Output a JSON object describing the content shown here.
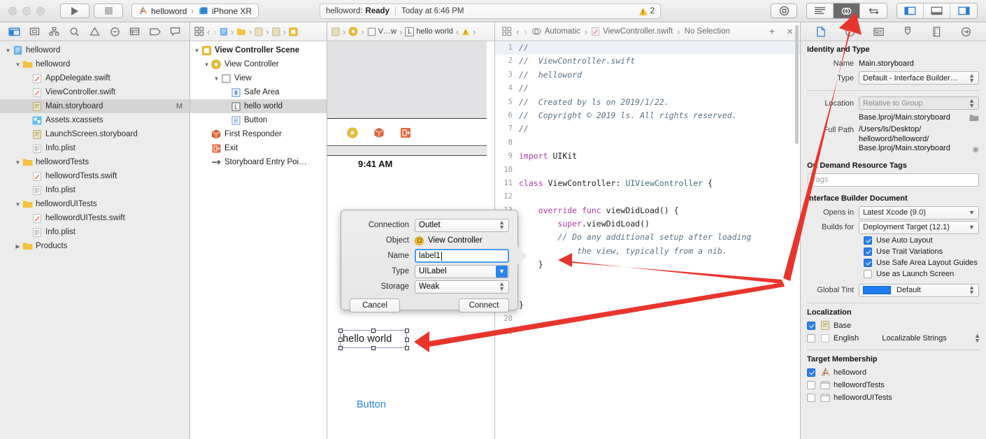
{
  "toolbar": {
    "run_label": "Run",
    "stop_label": "Stop",
    "scheme_project": "helloword",
    "scheme_device": "iPhone XR",
    "status_project": "helloword:",
    "status_state": "Ready",
    "status_time": "Today at 6:46 PM",
    "warning_count": "2",
    "accent": "#2a7fd4"
  },
  "navigator": {
    "tabs": [
      "folder-icon",
      "source-control-icon",
      "symbol-icon",
      "search-icon",
      "issue-icon",
      "test-icon",
      "debug-icon",
      "breakpoint-icon",
      "report-icon"
    ],
    "items": [
      {
        "label": "helloword",
        "depth": 0,
        "icon": "project-icon",
        "disc": "down",
        "sel": false,
        "flag": ""
      },
      {
        "label": "helloword",
        "depth": 1,
        "icon": "folder-icon",
        "disc": "down",
        "sel": false,
        "flag": ""
      },
      {
        "label": "AppDelegate.swift",
        "depth": 2,
        "icon": "swift-icon",
        "disc": "",
        "sel": false,
        "flag": ""
      },
      {
        "label": "ViewController.swift",
        "depth": 2,
        "icon": "swift-icon",
        "disc": "",
        "sel": false,
        "flag": ""
      },
      {
        "label": "Main.storyboard",
        "depth": 2,
        "icon": "storyboard-icon",
        "disc": "",
        "sel": true,
        "flag": "M"
      },
      {
        "label": "Assets.xcassets",
        "depth": 2,
        "icon": "assets-icon",
        "disc": "",
        "sel": false,
        "flag": ""
      },
      {
        "label": "LaunchScreen.storyboard",
        "depth": 2,
        "icon": "storyboard-icon",
        "disc": "",
        "sel": false,
        "flag": ""
      },
      {
        "label": "Info.plist",
        "depth": 2,
        "icon": "plist-icon",
        "disc": "",
        "sel": false,
        "flag": ""
      },
      {
        "label": "hellowordTests",
        "depth": 1,
        "icon": "folder-icon",
        "disc": "down",
        "sel": false,
        "flag": ""
      },
      {
        "label": "hellowordTests.swift",
        "depth": 2,
        "icon": "swift-icon",
        "disc": "",
        "sel": false,
        "flag": ""
      },
      {
        "label": "Info.plist",
        "depth": 2,
        "icon": "plist-icon",
        "disc": "",
        "sel": false,
        "flag": ""
      },
      {
        "label": "hellowordUITests",
        "depth": 1,
        "icon": "folder-icon",
        "disc": "down",
        "sel": false,
        "flag": ""
      },
      {
        "label": "hellowordUITests.swift",
        "depth": 2,
        "icon": "swift-icon",
        "disc": "",
        "sel": false,
        "flag": ""
      },
      {
        "label": "Info.plist",
        "depth": 2,
        "icon": "plist-icon",
        "disc": "",
        "sel": false,
        "flag": ""
      },
      {
        "label": "Products",
        "depth": 1,
        "icon": "folder-icon",
        "disc": "right",
        "sel": false,
        "flag": ""
      }
    ]
  },
  "outline": {
    "items": [
      {
        "label": "View Controller Scene",
        "depth": 0,
        "icon": "scene-icon",
        "disc": "down",
        "sel": false,
        "bold": true
      },
      {
        "label": "View Controller",
        "depth": 1,
        "icon": "viewcontroller-icon",
        "disc": "down",
        "sel": false,
        "bold": false
      },
      {
        "label": "View",
        "depth": 2,
        "icon": "view-icon",
        "disc": "down",
        "sel": false,
        "bold": false
      },
      {
        "label": "Safe Area",
        "depth": 3,
        "icon": "safearea-icon",
        "disc": "",
        "sel": false,
        "bold": false
      },
      {
        "label": "hello world",
        "depth": 3,
        "icon": "label-icon",
        "disc": "",
        "sel": true,
        "bold": false
      },
      {
        "label": "Button",
        "depth": 3,
        "icon": "button-icon",
        "disc": "",
        "sel": false,
        "bold": false
      },
      {
        "label": "First Responder",
        "depth": 1,
        "icon": "firstresponder-icon",
        "disc": "",
        "sel": false,
        "bold": false
      },
      {
        "label": "Exit",
        "depth": 1,
        "icon": "exit-icon",
        "disc": "",
        "sel": false,
        "bold": false
      },
      {
        "label": "Storyboard Entry Poi…",
        "depth": 1,
        "icon": "entrypoint-icon",
        "disc": "",
        "sel": false,
        "bold": false
      }
    ]
  },
  "canvas": {
    "jumpbar": [
      "V…w",
      "hello world"
    ],
    "status_time": "9:41 AM",
    "label_text": "hello world",
    "button_text": "Button"
  },
  "editor": {
    "jumpbar": {
      "automatic": "Automatic",
      "file": "ViewController.swift",
      "selection": "No Selection",
      "add_label": "+",
      "close_label": "×"
    },
    "lines": [
      {
        "n": "1",
        "text": "//",
        "kind": "comment"
      },
      {
        "n": "2",
        "text": "//  ViewController.swift",
        "kind": "comment"
      },
      {
        "n": "3",
        "text": "//  helloword",
        "kind": "comment"
      },
      {
        "n": "4",
        "text": "//",
        "kind": "comment"
      },
      {
        "n": "5",
        "text": "//  Created by ls on 2019/1/22.",
        "kind": "comment"
      },
      {
        "n": "6",
        "text": "//  Copyright © 2019 ls. All rights reserved.",
        "kind": "comment"
      },
      {
        "n": "7",
        "text": "//",
        "kind": "comment"
      },
      {
        "n": "8",
        "text": "",
        "kind": "plain"
      },
      {
        "n": "9",
        "text": "import UIKit",
        "kind": "import"
      },
      {
        "n": "10",
        "text": "",
        "kind": "plain"
      },
      {
        "n": "11",
        "text": "class ViewController: UIViewController {",
        "kind": "class"
      },
      {
        "n": "12",
        "text": "",
        "kind": "plain"
      },
      {
        "n": "13",
        "text": "    override func viewDidLoad() {",
        "kind": "func"
      },
      {
        "n": "14",
        "text": "        super.viewDidLoad()",
        "kind": "super"
      },
      {
        "n": "15",
        "text": "        // Do any additional setup after loading",
        "kind": "comment"
      },
      {
        "n": "",
        "text": "            the view, typically from a nib.",
        "kind": "comment"
      },
      {
        "n": "16",
        "text": "    }",
        "kind": "plain"
      },
      {
        "n": "17",
        "text": "",
        "kind": "plain"
      },
      {
        "n": "18",
        "text": "",
        "kind": "plain"
      },
      {
        "n": "19",
        "text": "}",
        "kind": "plain"
      },
      {
        "n": "20",
        "text": "",
        "kind": "plain"
      },
      {
        "n": "21",
        "text": "",
        "kind": "plain"
      }
    ]
  },
  "connection_dialog": {
    "connection_label": "Connection",
    "connection_value": "Outlet",
    "object_label": "Object",
    "object_value": "View Controller",
    "name_label": "Name",
    "name_value": "label1",
    "type_label": "Type",
    "type_value": "UILabel",
    "storage_label": "Storage",
    "storage_value": "Weak",
    "cancel_label": "Cancel",
    "connect_label": "Connect"
  },
  "inspector": {
    "tabs": [
      "file-inspector-icon",
      "quick-help-icon",
      "identity-inspector-icon",
      "attributes-inspector-icon",
      "size-inspector-icon",
      "connections-inspector-icon"
    ],
    "identity": {
      "section": "Identity and Type",
      "name_label": "Name",
      "name_value": "Main.storyboard",
      "type_label": "Type",
      "type_value": "Default - Interface Builder…",
      "location_label": "Location",
      "location_value": "Relative to Group",
      "location_path": "Base.lproj/Main.storyboard",
      "fullpath_label": "Full Path",
      "fullpath_value": "/Users/ls/Desktop/\nhelloword/helloword/\nBase.lproj/Main.storyboard"
    },
    "ondemand": {
      "section": "On Demand Resource Tags",
      "tags_placeholder": "Tags"
    },
    "ibdoc": {
      "section": "Interface Builder Document",
      "opens_in_label": "Opens in",
      "opens_in_value": "Latest Xcode (9.0)",
      "builds_for_label": "Builds for",
      "builds_for_value": "Deployment Target (12.1)",
      "checks": [
        {
          "label": "Use Auto Layout",
          "checked": true
        },
        {
          "label": "Use Trait Variations",
          "checked": true
        },
        {
          "label": "Use Safe Area Layout Guides",
          "checked": true
        },
        {
          "label": "Use as Launch Screen",
          "checked": false
        }
      ],
      "tint_label": "Global Tint",
      "tint_value": "Default",
      "tint_color": "#1a7ef0"
    },
    "localization": {
      "section": "Localization",
      "rows": [
        {
          "label": "Base",
          "checked": true,
          "right": ""
        },
        {
          "label": "English",
          "checked": false,
          "right": "Localizable Strings"
        }
      ]
    },
    "target_membership": {
      "section": "Target Membership",
      "rows": [
        {
          "label": "helloword",
          "checked": true
        },
        {
          "label": "hellowordTests",
          "checked": false
        },
        {
          "label": "hellowordUITests",
          "checked": false
        }
      ]
    }
  }
}
